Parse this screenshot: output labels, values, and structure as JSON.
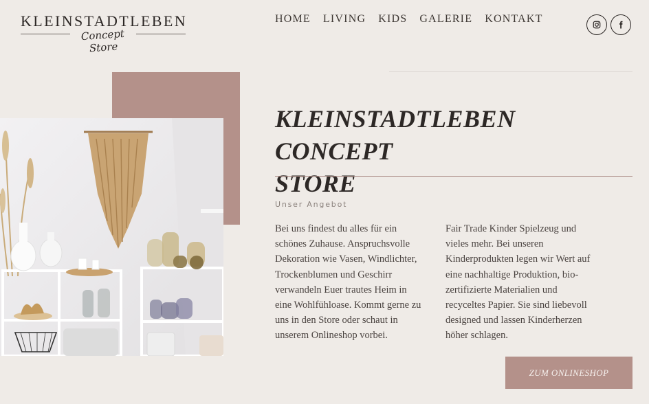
{
  "brand": {
    "title": "KLEINSTADTLEBEN",
    "subtitle": "Concept Store"
  },
  "nav": {
    "items": [
      {
        "label": "HOME"
      },
      {
        "label": "LIVING"
      },
      {
        "label": "KIDS"
      },
      {
        "label": "GALERIE"
      },
      {
        "label": "KONTAKT"
      }
    ]
  },
  "social": {
    "icons": [
      "instagram-icon",
      "facebook-icon"
    ]
  },
  "hero": {
    "heading_line1": "KLEINSTADTLEBEN CONCEPT",
    "heading_line2": "STORE",
    "kicker": "Unser Angebot",
    "col1": "Bei uns findest du alles für ein schönes Zuhause. Anspruchsvolle Dekoration wie Vasen, Windlichter, Trockenblumen und Geschirr verwandeln Euer trautes Heim in eine Wohlfühloase. Kommt gerne zu uns in den Store oder schaut in unserem Onlineshop vorbei.",
    "col2": "Fair Trade Kinder Spielzeug und vieles mehr. Bei unseren Kinderprodukten legen wir Wert auf eine nachhaltige Produktion, bio- zertifizierte Materialien und recyceltes Papier. Sie sind liebevoll designed und lassen Kinderherzen höher schlagen.",
    "cta_label": "ZUM ONLINESHOP"
  },
  "colors": {
    "background": "#efebe7",
    "accent_rose": "#b4918a",
    "text_dark": "#2d2826"
  }
}
